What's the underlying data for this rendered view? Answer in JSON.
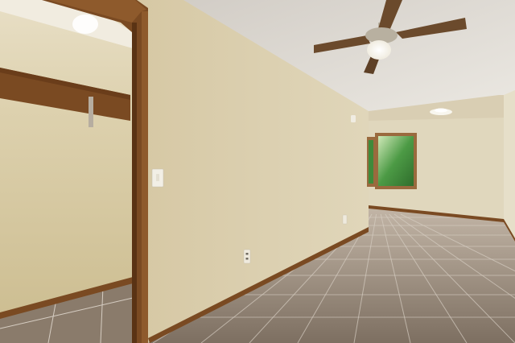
{
  "scene": {
    "colors": {
      "wall_left": "#ddd2b2",
      "wall_center": "#d8cba8",
      "wall_back": "#e0d7bd",
      "wall_right": "#e6dfc9",
      "closet_wall": "#d5c89e",
      "closet_wall_upper": "#e6dcc0",
      "ceiling": "#e3e0da",
      "ceiling_dark": "#cfcac2",
      "wood_trim": "#7a4a22",
      "wood_trim_dark": "#5a3314",
      "floor": "#8f8172",
      "floor_light": "#b9ab9b",
      "grout": "#d6cdc2",
      "window_foliage": "#3f8a3a",
      "window_light": "#d8f0c4",
      "fan_blade": "#6b4a2c",
      "fan_metal": "#b8b0a0",
      "fan_light": "#f4f1e8",
      "switch_plate": "#f2efe6",
      "outlet": "#efeadd"
    },
    "icons": {
      "ceiling_fan": "ceiling-fan-icon",
      "light_fixture": "ceiling-light-icon",
      "light_switch": "light-switch-icon",
      "outlet": "outlet-icon",
      "window": "window-icon"
    }
  }
}
